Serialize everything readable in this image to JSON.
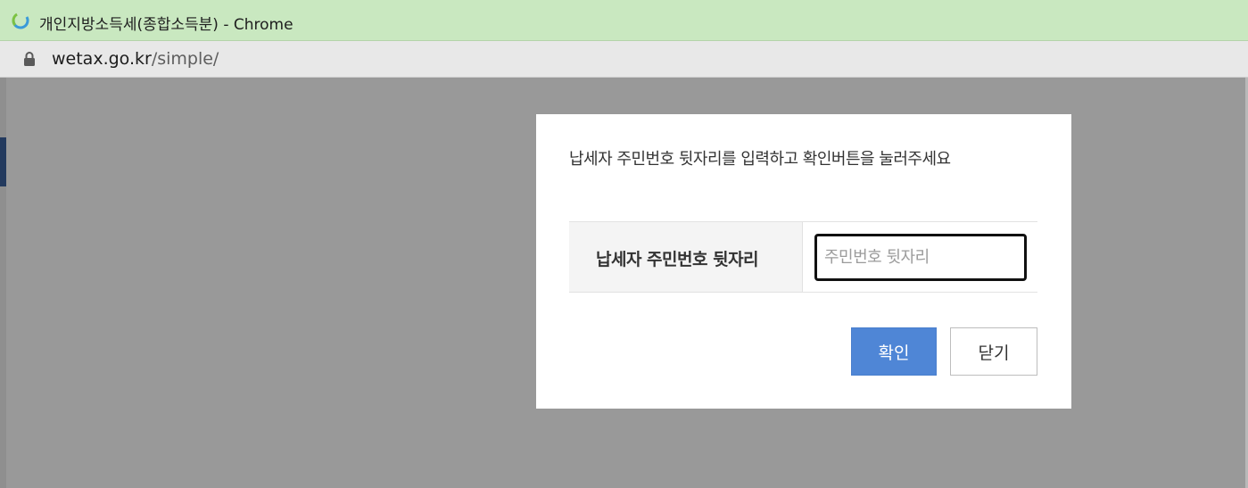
{
  "browser": {
    "window_title": "개인지방소득세(종합소득분) - Chrome",
    "url_host": "wetax.go.kr",
    "url_path": "/simple/"
  },
  "dialog": {
    "instruction": "납세자 주민번호 뒷자리를 입력하고 확인버튼을 눌러주세요",
    "field_label": "납세자 주민번호 뒷자리",
    "field_value": "",
    "field_placeholder": "주민번호 뒷자리",
    "confirm_label": "확인",
    "close_label": "닫기"
  },
  "colors": {
    "titlebar": "#c9e8c0",
    "overlay": "#999999",
    "confirm_button": "#4f86d6"
  },
  "icons": {
    "site": "wetax-logo-icon",
    "lock": "lock-icon"
  }
}
